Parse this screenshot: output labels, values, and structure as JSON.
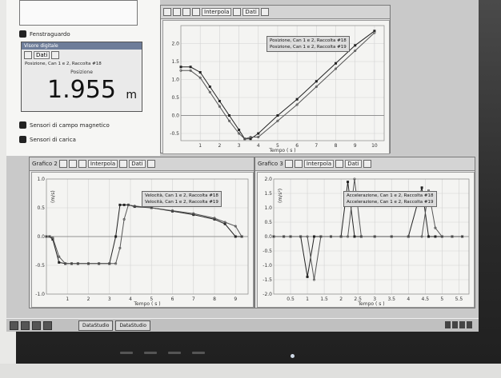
{
  "app": {
    "sidebar": {
      "items": [
        {
          "label": "Fenstraguardo"
        },
        {
          "label": "Sensori di campo magnetico"
        },
        {
          "label": "Sensori di carica"
        }
      ]
    },
    "meter": {
      "title": "Visore digitale",
      "series": "Posizione, Can 1 e 2, Raccolta #18",
      "caption": "Posizione",
      "value": "1.955",
      "unit": "m",
      "menu": "Dati"
    },
    "toolbar": {
      "interpola": "Interpola",
      "dati": "Dati"
    },
    "graph_top": {
      "title": "",
      "legend": [
        "Posizione, Can 1 e 2, Raccolta #18",
        "Posizione, Can 1 e 2, Raccolta #19"
      ],
      "xlabel": "Tempo ( s )"
    },
    "graph_left": {
      "title": "Grafico 2",
      "legend": [
        "Velocità, Can 1 e 2, Raccolta #18",
        "Velocità, Can 1 e 2, Raccolta #19"
      ],
      "xlabel": "Tempo ( s )",
      "ylabel": "(m/s)"
    },
    "graph_right": {
      "title": "Grafico 3",
      "legend": [
        "Accelerazione, Can 1 e 2, Raccolta #18",
        "Accelerazione, Can 1 e 2, Raccolta #19"
      ],
      "xlabel": "Tempo ( s )",
      "ylabel": "(m/s²)"
    },
    "taskbar": {
      "tasks": [
        "DataStudio",
        "DataStudio"
      ]
    },
    "colors": {
      "accent": "#6e7d99",
      "series1": "#333333",
      "series2": "#666666"
    }
  },
  "chart_data": [
    {
      "type": "line",
      "name": "position",
      "x": [
        0,
        0.5,
        1,
        1.5,
        2,
        2.5,
        3,
        3.3,
        3.6,
        4,
        5,
        6,
        7,
        8,
        9,
        10
      ],
      "series": [
        {
          "name": "Posizione, Can 1 e 2, Raccolta #18",
          "values": [
            1.35,
            1.35,
            1.2,
            0.8,
            0.4,
            0.0,
            -0.4,
            -0.65,
            -0.65,
            -0.5,
            0.0,
            0.45,
            0.95,
            1.45,
            1.95,
            2.35
          ]
        },
        {
          "name": "Posizione, Can 1 e 2, Raccolta #19",
          "values": [
            1.25,
            1.25,
            1.05,
            0.65,
            0.25,
            -0.15,
            -0.5,
            -0.65,
            -0.6,
            -0.6,
            -0.15,
            0.3,
            0.8,
            1.3,
            1.8,
            2.3
          ]
        }
      ],
      "xlim": [
        0,
        10.5
      ],
      "ylim": [
        -0.7,
        2.5
      ],
      "xticks": [
        1,
        2,
        3,
        4,
        5,
        6,
        7,
        8,
        9,
        10
      ],
      "yticks": [
        2.0,
        1.5,
        1.0,
        0.5,
        0.0,
        -0.5
      ],
      "xlabel": "Tempo ( s )",
      "ylabel": "",
      "title": "",
      "grid": true,
      "legend": "top-right"
    },
    {
      "type": "line",
      "name": "velocity",
      "x": [
        0,
        0.15,
        0.3,
        0.6,
        0.9,
        1.2,
        1.5,
        2.0,
        2.5,
        3.0,
        3.3,
        3.5,
        3.7,
        3.9,
        4.2,
        5,
        6,
        7,
        8,
        8.5,
        9,
        9.3
      ],
      "series": [
        {
          "name": "Velocità, Can 1 e 2, Raccolta #18",
          "values": [
            0.0,
            0.0,
            -0.05,
            -0.45,
            -0.47,
            -0.47,
            -0.47,
            -0.47,
            -0.47,
            -0.47,
            0.0,
            0.55,
            0.55,
            0.55,
            0.52,
            0.5,
            0.44,
            0.38,
            0.3,
            0.22,
            0.0,
            0.0
          ]
        },
        {
          "name": "Velocità, Can 1 e 2, Raccolta #19",
          "values": [
            0.0,
            0.0,
            -0.02,
            -0.35,
            -0.47,
            -0.47,
            -0.47,
            -0.47,
            -0.47,
            -0.47,
            -0.47,
            -0.2,
            0.3,
            0.55,
            0.53,
            0.5,
            0.45,
            0.4,
            0.32,
            0.25,
            0.18,
            0.0
          ]
        }
      ],
      "xlim": [
        0,
        9.6
      ],
      "ylim": [
        -1.0,
        1.0
      ],
      "xticks": [
        1,
        2,
        3,
        4,
        5,
        6,
        7,
        8,
        9
      ],
      "yticks": [
        1.0,
        0.5,
        0.0,
        -0.5,
        -1.0
      ],
      "xlabel": "Tempo ( s )",
      "ylabel": "(m/s)",
      "title": "Grafico 2",
      "grid": true,
      "legend": "top-center"
    },
    {
      "type": "line",
      "name": "acceleration",
      "x": [
        0,
        0.3,
        0.5,
        0.8,
        1.0,
        1.2,
        1.4,
        1.7,
        2.0,
        2.2,
        2.4,
        2.6,
        3.0,
        3.5,
        4.0,
        4.4,
        4.6,
        4.8,
        5.0,
        5.3,
        5.6
      ],
      "series": [
        {
          "name": "Accelerazione, Can 1 e 2, Raccolta #18",
          "values": [
            0,
            0,
            0,
            0,
            -1.4,
            0,
            0,
            0,
            0,
            1.9,
            0,
            0,
            0,
            0,
            0,
            1.7,
            0,
            0,
            0,
            0,
            0
          ]
        },
        {
          "name": "Accelerazione, Can 1 e 2, Raccolta #19",
          "values": [
            0,
            0,
            0,
            0,
            0,
            -1.5,
            0,
            0,
            0,
            0,
            2.0,
            0,
            0,
            0,
            0,
            0,
            1.6,
            0.3,
            0,
            0,
            0
          ]
        }
      ],
      "xlim": [
        0,
        5.8
      ],
      "ylim": [
        -2.0,
        2.0
      ],
      "xticks": [
        0.5,
        1.0,
        1.5,
        2.0,
        2.5,
        3.0,
        3.5,
        4.0,
        4.5,
        5.0,
        5.5
      ],
      "yticks": [
        2.0,
        1.5,
        1.0,
        0.5,
        0.0,
        -0.5,
        -1.0,
        -1.5,
        -2.0
      ],
      "xlabel": "Tempo ( s )",
      "ylabel": "(m/s²)",
      "title": "Grafico 3",
      "grid": true,
      "legend": "top-center"
    }
  ]
}
